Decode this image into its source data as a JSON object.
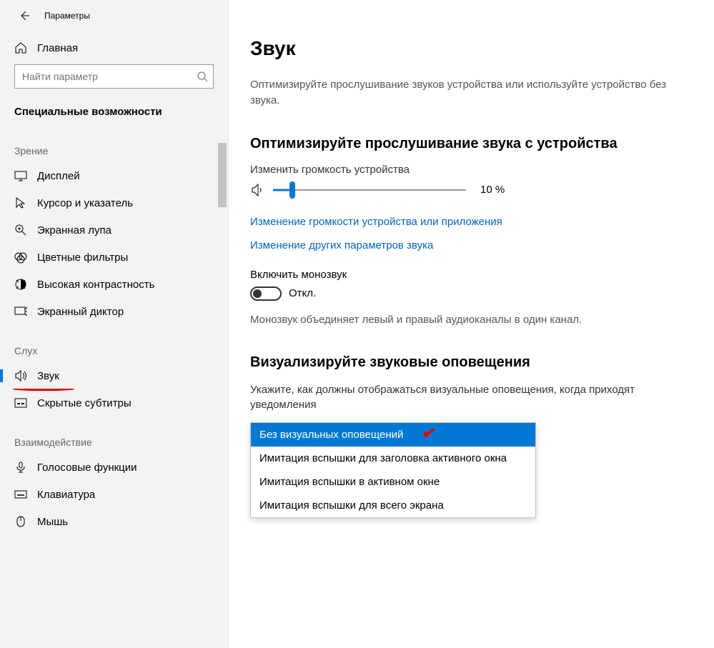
{
  "window": {
    "title": "Параметры"
  },
  "sidebar": {
    "home": "Главная",
    "search_placeholder": "Найти параметр",
    "category": "Специальные возможности",
    "groups": [
      {
        "label": "Зрение",
        "items": [
          {
            "icon": "display-icon",
            "label": "Дисплей"
          },
          {
            "icon": "cursor-icon",
            "label": "Курсор и указатель"
          },
          {
            "icon": "magnifier-icon",
            "label": "Экранная лупа"
          },
          {
            "icon": "color-filter-icon",
            "label": "Цветные фильтры"
          },
          {
            "icon": "contrast-icon",
            "label": "Высокая контрастность"
          },
          {
            "icon": "narrator-icon",
            "label": "Экранный диктор"
          }
        ]
      },
      {
        "label": "Слух",
        "items": [
          {
            "icon": "sound-icon",
            "label": "Звук",
            "active": true
          },
          {
            "icon": "captions-icon",
            "label": "Скрытые субтитры"
          }
        ]
      },
      {
        "label": "Взаимодействие",
        "items": [
          {
            "icon": "voice-icon",
            "label": "Голосовые функции"
          },
          {
            "icon": "keyboard-icon",
            "label": "Клавиатура"
          },
          {
            "icon": "mouse-icon",
            "label": "Мышь"
          }
        ]
      }
    ]
  },
  "main": {
    "title": "Звук",
    "desc": "Оптимизируйте прослушивание звуков устройства или используйте устройство без звука.",
    "optimize": {
      "heading": "Оптимизируйте прослушивание звука с устройства",
      "volume_label": "Изменить громкость устройства",
      "volume_value": "10 %",
      "link1": "Изменение громкости устройства или приложения",
      "link2": "Изменение других параметров звука",
      "mono_label": "Включить монозвук",
      "mono_state": "Откл.",
      "mono_desc": "Монозвук объединяет левый и правый аудиоканалы в один канал."
    },
    "visual": {
      "heading": "Визуализируйте звуковые оповещения",
      "desc": "Укажите, как должны отображаться визуальные оповещения, когда приходят уведомления",
      "options": [
        "Без визуальных оповещений",
        "Имитация вспышки для заголовка активного окна",
        "Имитация вспышки в активном окне",
        "Имитация вспышки для всего экрана"
      ],
      "selected_index": 0
    }
  }
}
